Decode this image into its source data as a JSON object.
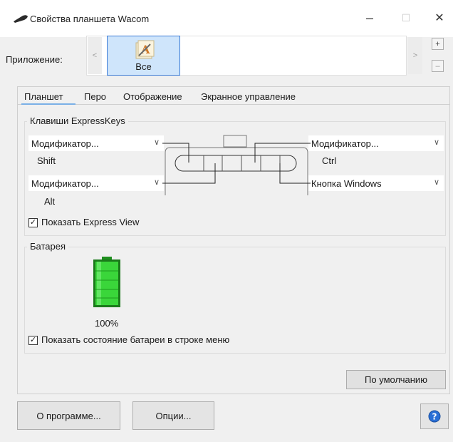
{
  "window": {
    "title": "Свойства планшета Wacom",
    "minimize": "–",
    "maximize": "☐",
    "close": "✕"
  },
  "app_row": {
    "label": "Приложение:",
    "scroll_left": "<",
    "scroll_right": ">",
    "selected_app": "Все",
    "add": "+",
    "remove": "–"
  },
  "tabs": [
    {
      "label": "Планшет",
      "active": true
    },
    {
      "label": "Перо",
      "active": false
    },
    {
      "label": "Отображение",
      "active": false
    },
    {
      "label": "Экранное управление",
      "active": false
    }
  ],
  "expresskeys": {
    "legend": "Клавиши ExpressKeys",
    "key1": {
      "value": "Модификатор...",
      "sub": "Shift"
    },
    "key2": {
      "value": "Модификатор...",
      "sub": "Alt"
    },
    "key3": {
      "value": "Модификатор...",
      "sub": "Ctrl"
    },
    "key4": {
      "value": "Кнопка Windows"
    },
    "show_express_view": {
      "label": "Показать Express View",
      "checked": true
    }
  },
  "battery": {
    "legend": "Батарея",
    "percent_label": "100%",
    "level": 1.0,
    "color": "#3ad63a",
    "show_in_menu": {
      "label": "Показать состояние батареи в строке меню",
      "checked": true
    }
  },
  "buttons": {
    "defaults": "По умолчанию",
    "about": "О программе...",
    "options": "Опции...",
    "help_icon": "help-icon"
  },
  "colors": {
    "accent": "#3b7bd6",
    "help_blue": "#2a6fd6"
  }
}
